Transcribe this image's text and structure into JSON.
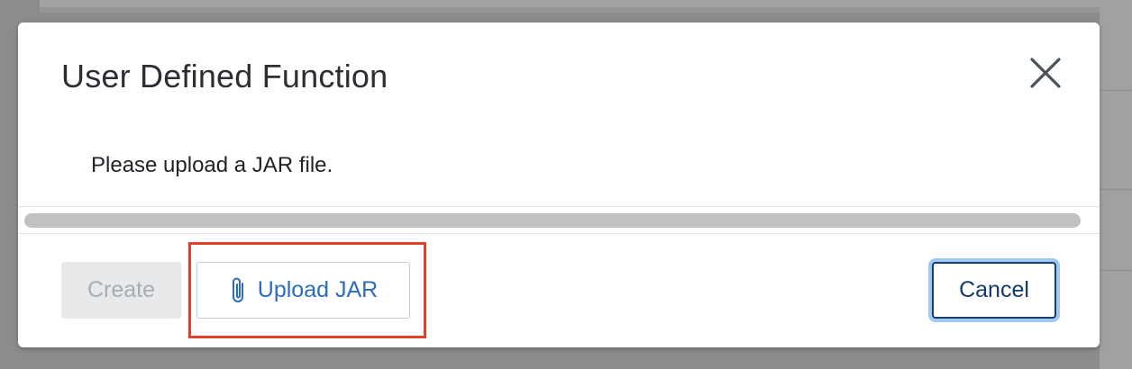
{
  "dialog": {
    "title": "User Defined Function",
    "message": "Please upload a JAR file."
  },
  "buttons": {
    "create_label": "Create",
    "upload_label": "Upload JAR",
    "cancel_label": "Cancel"
  },
  "icons": {
    "close": "close-icon",
    "upload": "paperclip-icon"
  },
  "colors": {
    "accent_link": "#2a6ebb",
    "cancel_text": "#123a6b",
    "focus_ring": "#9fcbf3",
    "highlight_annotation": "#e4402a",
    "disabled_bg": "#e8e9ea"
  }
}
